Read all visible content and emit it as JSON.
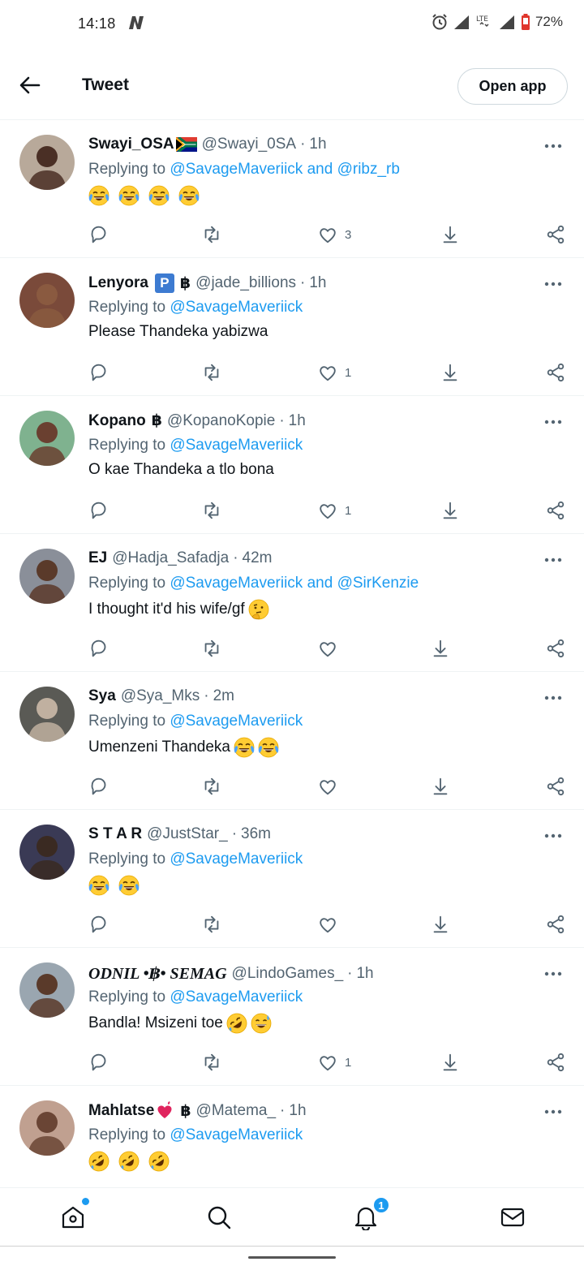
{
  "status_bar": {
    "time": "14:18",
    "battery": "72%",
    "network": "LTE"
  },
  "header": {
    "title": "Tweet",
    "open_app_label": "Open app"
  },
  "tweets": [
    {
      "name": "Swayi_OSA",
      "name_suffix": "flag-south-africa",
      "handle": "@Swayi_0SA",
      "time": "1h",
      "replying_prefix": "Replying to ",
      "mentions": [
        "@SavageMaveriick",
        "@ribz_rb"
      ],
      "text": "",
      "emojis": [
        "tears-of-joy",
        "tears-of-joy",
        "tears-of-joy",
        "tears-of-joy"
      ],
      "likes": "3"
    },
    {
      "name": "Lenyora",
      "badge": "P",
      "baht": "฿",
      "handle": "@jade_billions",
      "time": "1h",
      "replying_prefix": "Replying to ",
      "mentions": [
        "@SavageMaveriick"
      ],
      "text": "Please Thandeka yabizwa",
      "emojis": [],
      "likes": "1"
    },
    {
      "name": "Kopano",
      "baht": "฿",
      "handle": "@KopanoKopie",
      "time": "1h",
      "replying_prefix": "Replying to ",
      "mentions": [
        "@SavageMaveriick"
      ],
      "text": "O kae Thandeka a tlo bona",
      "emojis": [],
      "likes": "1"
    },
    {
      "name": "EJ",
      "handle": "@Hadja_Safadja",
      "time": "42m",
      "replying_prefix": "Replying to ",
      "mentions": [
        "@SavageMaveriick",
        "@SirKenzie"
      ],
      "text": "I thought it'd his wife/gf",
      "emojis": [
        "thinking-face"
      ],
      "likes": ""
    },
    {
      "name": "Sya",
      "handle": "@Sya_Mks",
      "time": "2m",
      "replying_prefix": "Replying to ",
      "mentions": [
        "@SavageMaveriick"
      ],
      "text": "Umenzeni Thandeka",
      "emojis": [
        "tears-of-joy",
        "tears-of-joy"
      ],
      "likes": ""
    },
    {
      "name": "S T A R",
      "handle": "@JustStar_",
      "time": "36m",
      "replying_prefix": "Replying to ",
      "mentions": [
        "@SavageMaveriick"
      ],
      "text": "",
      "emojis": [
        "tears-of-joy",
        "tears-of-joy"
      ],
      "likes": ""
    },
    {
      "name": "ODNIL •฿• SEMAG",
      "fancy": true,
      "handle": "@LindoGames_",
      "time": "1h",
      "replying_prefix": "Replying to ",
      "mentions": [
        "@SavageMaveriick"
      ],
      "text": "Bandla! Msizeni toe",
      "emojis": [
        "rofl",
        "grinning-sweat"
      ],
      "likes": "1"
    },
    {
      "name": "Mahlatse",
      "name_suffix": "heart-exclamation",
      "baht": "฿",
      "handle": "@Matema_",
      "time": "1h",
      "replying_prefix": "Replying to ",
      "mentions": [
        "@SavageMaveriick"
      ],
      "text": "",
      "emojis": [
        "rofl",
        "rofl",
        "rofl"
      ],
      "likes": ""
    }
  ],
  "joiner_and": " and ",
  "time_separator": "·",
  "bottom_nav": {
    "notifications_count": "1"
  },
  "colors": {
    "accent": "#1d9bf0",
    "text": "#0f1419",
    "muted": "#536471",
    "divider": "#eff3f4"
  }
}
